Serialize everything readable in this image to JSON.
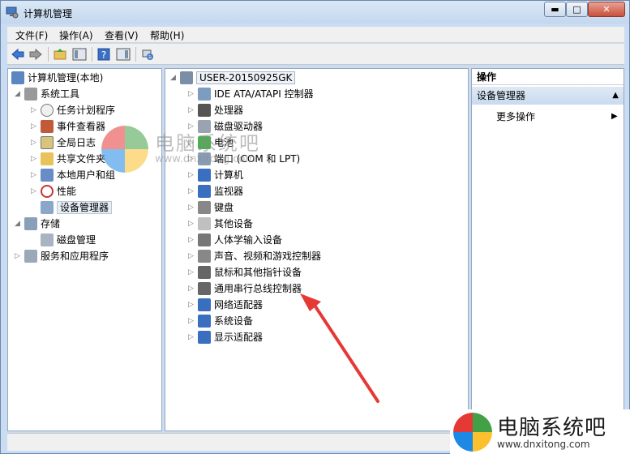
{
  "window": {
    "title": "计算机管理",
    "minimize": "▬",
    "maximize": "□",
    "close": "✕"
  },
  "menubar": {
    "items": [
      "文件(F)",
      "操作(A)",
      "查看(V)",
      "帮助(H)"
    ]
  },
  "left_tree": {
    "root": "计算机管理(本地)",
    "system_tools": "系统工具",
    "items": [
      "任务计划程序",
      "事件查看器",
      "全局日志",
      "共享文件夹",
      "本地用户和组",
      "性能",
      "设备管理器"
    ],
    "storage": "存储",
    "disk_mgmt": "磁盘管理",
    "services": "服务和应用程序"
  },
  "device_tree": {
    "computer": "USER-20150925GK",
    "devices": [
      "IDE ATA/ATAPI 控制器",
      "处理器",
      "磁盘驱动器",
      "电池",
      "端口 (COM 和 LPT)",
      "计算机",
      "监视器",
      "键盘",
      "其他设备",
      "人体学输入设备",
      "声音、视频和游戏控制器",
      "鼠标和其他指针设备",
      "通用串行总线控制器",
      "网络适配器",
      "系统设备",
      "显示适配器"
    ]
  },
  "actions": {
    "header": "操作",
    "section": "设备管理器",
    "more": "更多操作"
  },
  "watermark": {
    "text": "电脑系统吧",
    "url": "www.dnxitong.com"
  },
  "colors": {
    "arrow": "#e53935",
    "selection": "#c9dbef"
  }
}
